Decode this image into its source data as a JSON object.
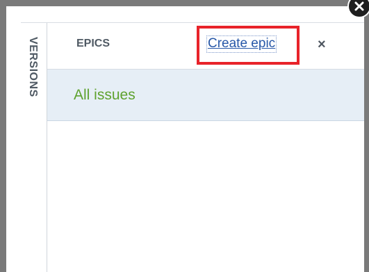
{
  "rail": {
    "versions_label": "VERSIONS"
  },
  "epics_panel": {
    "title": "EPICS",
    "create_label": "Create epic",
    "close_symbol": "×",
    "all_issues_label": "All issues"
  },
  "icons": {
    "corner_close": "close-icon",
    "panel_close": "close-icon"
  },
  "colors": {
    "highlight_box": "#e8232a",
    "link": "#2858a8",
    "all_issues_text": "#5ea22e",
    "selected_row_bg": "#e6eef6"
  }
}
